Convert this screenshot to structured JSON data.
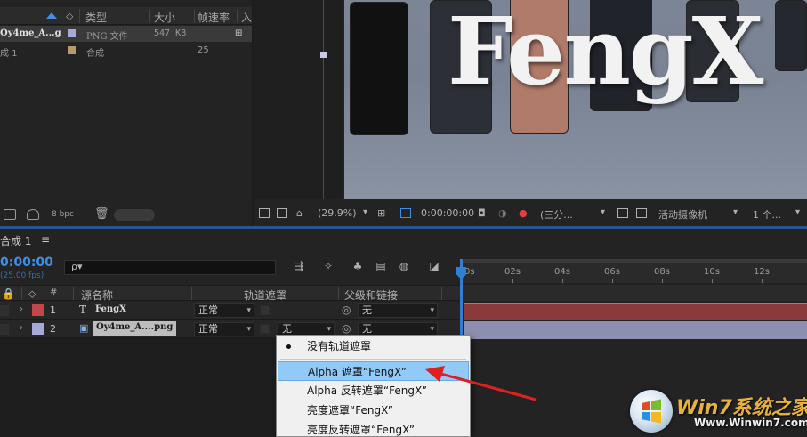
{
  "project": {
    "columns": {
      "type": "类型",
      "size": "大小",
      "fps": "帧速率",
      "extra": "入"
    },
    "rows": [
      {
        "name": "Oy4me_A...g",
        "type": "PNG 文件",
        "size": "547 KB",
        "fps": "",
        "swatch": "#a7a9d8"
      },
      {
        "name": "成 1",
        "type": "合成",
        "size": "",
        "fps": "25",
        "swatch": "#b89a6a"
      }
    ],
    "footer": {
      "bpc": "8 bpc"
    }
  },
  "viewer": {
    "preview_text": "FengX",
    "toolbar": {
      "zoom": "(29.9%)",
      "timecode": "0:00:00:00",
      "resolution": "(三分...",
      "camera": "活动摄像机",
      "views": "1 个..."
    }
  },
  "timeline": {
    "tab": "合成 1",
    "timecode": "0:00:00",
    "fps": "(25.00 fps)",
    "search_placeholder": "ρ▾",
    "headers": {
      "num": "#",
      "source": "源名称",
      "trackmatte": "轨道遮罩",
      "parent": "父级和链接"
    },
    "layers": [
      {
        "num": "1",
        "type": "T",
        "name": "FengX",
        "mode": "正常",
        "matte": "",
        "parent": "无",
        "color": "#c04848"
      },
      {
        "num": "2",
        "type": "▣",
        "name": "Oy4me_A....png",
        "mode": "正常",
        "matte": "无",
        "parent": "无",
        "color": "#a7a9d8"
      }
    ],
    "ruler": [
      "0s",
      "02s",
      "04s",
      "06s",
      "08s",
      "10s",
      "12s"
    ]
  },
  "menu": {
    "items": [
      {
        "label": "没有轨道遮罩",
        "checked": true
      },
      {
        "label": "Alpha 遮罩“FengX”",
        "highlighted": true
      },
      {
        "label": "Alpha 反转遮罩“FengX”"
      },
      {
        "label": "亮度遮罩“FengX”"
      },
      {
        "label": "亮度反转遮罩“FengX”"
      }
    ]
  },
  "watermark": {
    "brand": "Win7系统之家",
    "url": "Www.Winwin7.com"
  },
  "colors": {
    "accent": "#3f8fe6",
    "highlight": "#91c9f7",
    "arrow": "#e02020"
  }
}
